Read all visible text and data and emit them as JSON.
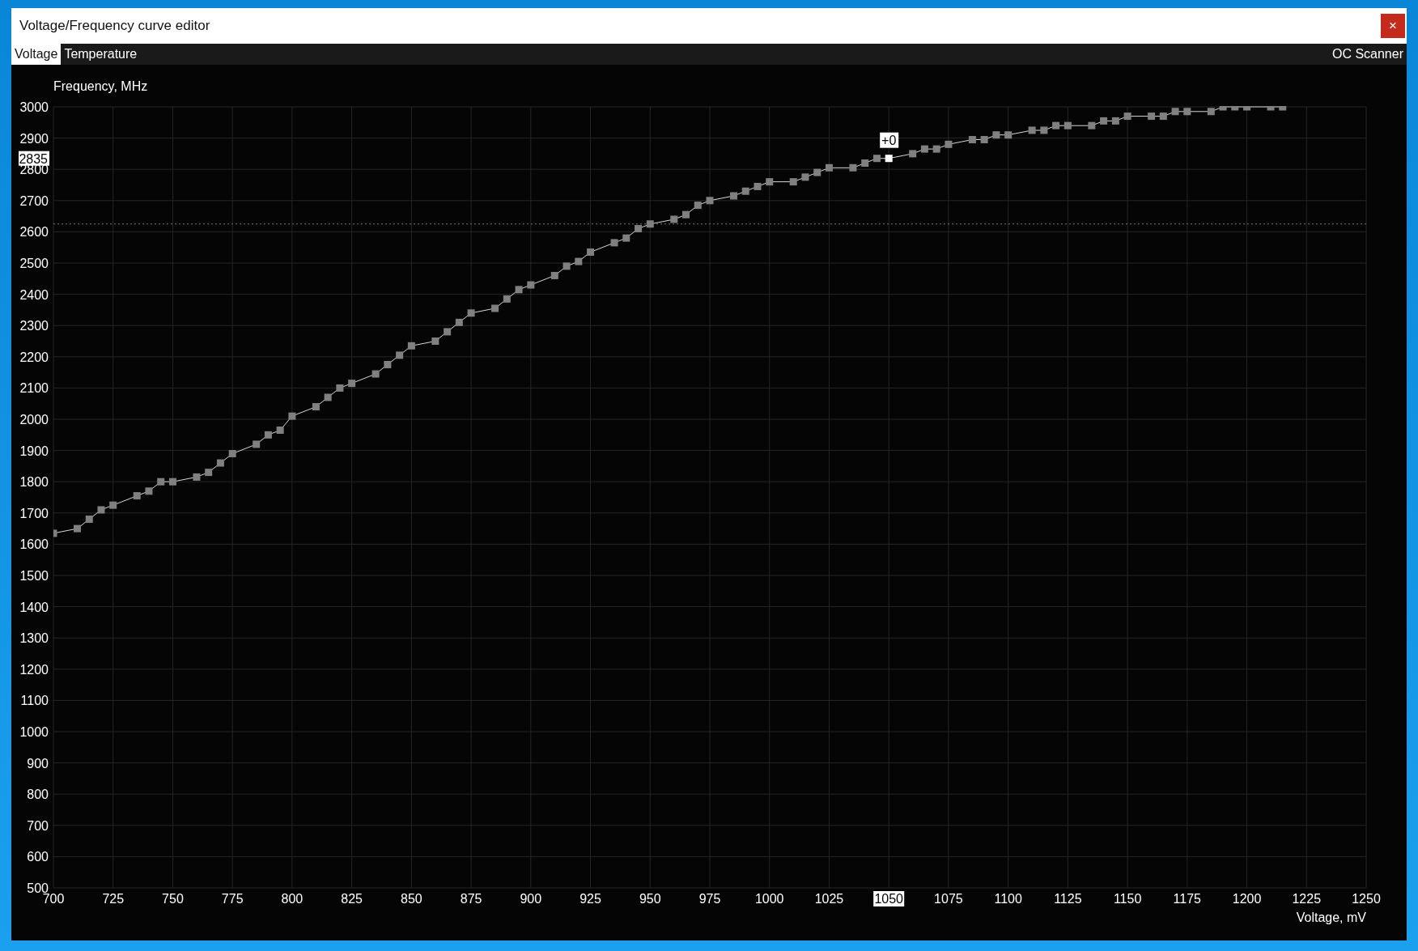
{
  "window": {
    "title": "Voltage/Frequency curve editor",
    "close_glyph": "×"
  },
  "tabs": [
    {
      "label": "Voltage",
      "selected": true
    },
    {
      "label": "Temperature",
      "selected": false
    }
  ],
  "oc_scanner": {
    "label": "OC Scanner"
  },
  "chart_data": {
    "type": "line",
    "xlabel": "Voltage, mV",
    "ylabel": "Frequency, MHz",
    "x": [
      700,
      710,
      715,
      720,
      725,
      735,
      740,
      745,
      750,
      760,
      765,
      770,
      775,
      785,
      790,
      795,
      800,
      810,
      815,
      820,
      825,
      835,
      840,
      845,
      850,
      860,
      865,
      870,
      875,
      885,
      890,
      895,
      900,
      910,
      915,
      920,
      925,
      935,
      940,
      945,
      950,
      960,
      965,
      970,
      975,
      985,
      990,
      995,
      1000,
      1010,
      1015,
      1020,
      1025,
      1035,
      1040,
      1045,
      1050,
      1060,
      1065,
      1070,
      1075,
      1085,
      1090,
      1095,
      1100,
      1110,
      1115,
      1120,
      1125,
      1135,
      1140,
      1145,
      1150,
      1160,
      1165,
      1170,
      1175,
      1185,
      1190,
      1195,
      1200,
      1210,
      1215
    ],
    "grid": true,
    "series": [
      {
        "color": "#808080",
        "marker": "square",
        "values": [
          1635,
          1650,
          1680,
          1710,
          1725,
          1755,
          1770,
          1800,
          1800,
          1815,
          1830,
          1860,
          1890,
          1920,
          1950,
          1965,
          2010,
          2040,
          2070,
          2100,
          2115,
          2145,
          2175,
          2205,
          2235,
          2250,
          2280,
          2310,
          2340,
          2355,
          2385,
          2415,
          2430,
          2460,
          2490,
          2505,
          2535,
          2565,
          2580,
          2610,
          2625,
          2640,
          2655,
          2685,
          2700,
          2715,
          2730,
          2745,
          2760,
          2760,
          2775,
          2790,
          2805,
          2805,
          2820,
          2835,
          2835,
          2850,
          2865,
          2865,
          2880,
          2895,
          2895,
          2910,
          2910,
          2925,
          2925,
          2940,
          2940,
          2940,
          2955,
          2955,
          2970,
          2970,
          2970,
          2985,
          2985,
          2985,
          3000,
          3000,
          3000,
          3000,
          3000
        ]
      }
    ],
    "xlim": [
      700,
      1250
    ],
    "ylim": [
      500,
      3000
    ],
    "xticks": [
      700,
      725,
      750,
      775,
      800,
      825,
      850,
      875,
      900,
      925,
      950,
      975,
      1000,
      1025,
      1050,
      1075,
      1100,
      1125,
      1150,
      1175,
      1200,
      1225,
      1250
    ],
    "yticks": [
      500,
      600,
      700,
      800,
      900,
      1000,
      1100,
      1200,
      1300,
      1400,
      1500,
      1600,
      1700,
      1800,
      1900,
      2000,
      2100,
      2200,
      2300,
      2400,
      2500,
      2600,
      2700,
      2800,
      2900,
      3000
    ],
    "ref_lines": [
      {
        "axis": "y",
        "value": 2625
      }
    ]
  },
  "cursor": {
    "offset_label": "+0",
    "frequency_label": "2835",
    "voltage_label": "1050"
  }
}
